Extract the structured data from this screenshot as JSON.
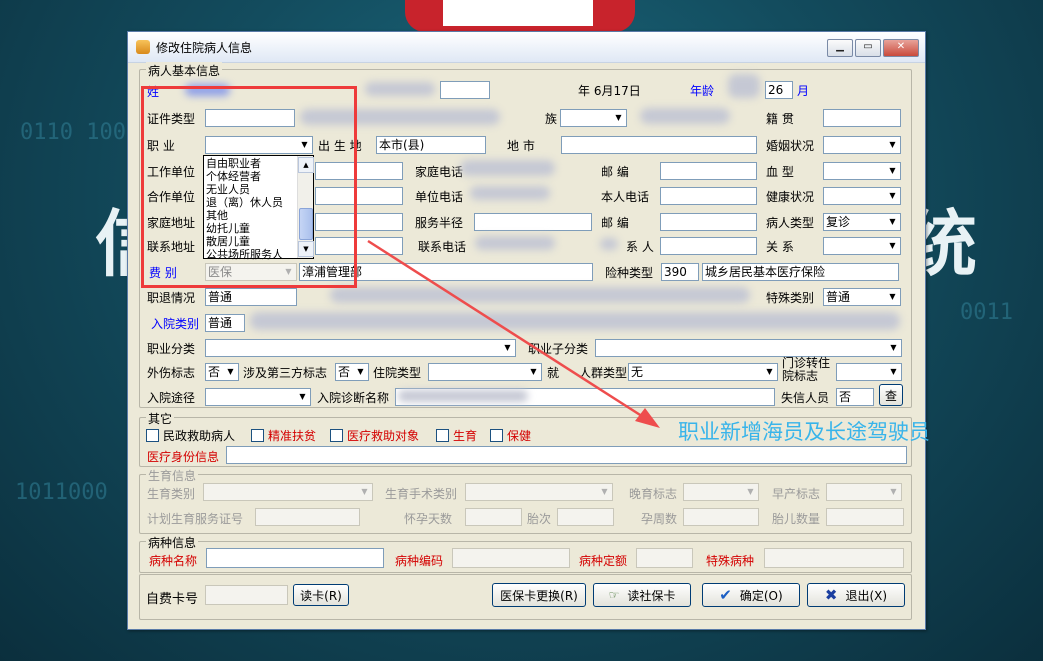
{
  "window": {
    "title": "修改住院病人信息"
  },
  "annotation": "职业新增海员及长途驾驶员",
  "basic": {
    "title": "病人基本信息",
    "name_label": "姓",
    "date_frag": "年 6月17日",
    "age_label": "年龄",
    "age_value": "26",
    "month_label": "月",
    "idtype_label": "证件类型",
    "nation_frag": "族",
    "native_label": "籍    贯",
    "job_label": "职    业",
    "birthplace_label": "出 生 地",
    "birthplace_value": "本市(县)",
    "city_label": "地    市",
    "marital_label": "婚姻状况",
    "work_label": "工作单位",
    "homephone_label": "家庭电话",
    "postcode_label": "邮    编",
    "blood_label": "血    型",
    "coop_label": "合作单位",
    "unitphone_label": "单位电话",
    "selfphone_label": "本人电话",
    "health_label": "健康状况",
    "homeaddr_label": "家庭地址",
    "radius_label": "服务半径",
    "postcode2_label": "邮    编",
    "patienttype_label": "病人类型",
    "patienttype_value": "复诊",
    "contactaddr_label": "联系地址",
    "contactphone_label": "联系电话",
    "contact_label": "系 人",
    "relation_label": "关    系",
    "fee_label": "费    别",
    "fee_value": "医保",
    "fee_unit": "漳浦管理部",
    "insure_label": "险种类型",
    "insure_code": "390",
    "insure_name": "城乡居民基本医疗保险",
    "staff_label": "职退情况",
    "staff_value": "普通",
    "special_label": "特殊类别",
    "special_value": "普通",
    "admitcat_label": "入院类别",
    "admitcat_value": "普通",
    "jobcat_label": "职业分类",
    "jobsub_label": "职业子分类",
    "injury_label": "外伤标志",
    "injury_value": "否",
    "third_label": "涉及第三方标志",
    "third_value": "否",
    "admtype_label": "住院类型",
    "crowd_label": "就",
    "crowd_label2": "人群类型",
    "crowd_value": "无",
    "outpat_label": "门诊转住院标志",
    "route_label": "入院途径",
    "diag_label": "入院诊断名称",
    "lost_label": "失信人员",
    "lost_value": "否",
    "query_button": "查"
  },
  "job_options": [
    "自由职业者",
    "个体经营者",
    "无业人员",
    "退（离）休人员",
    "其他",
    "幼托儿童",
    "散居儿童",
    "公共场所服务人"
  ],
  "other": {
    "title": "其它",
    "checks": [
      "民政救助病人",
      "精准扶贫",
      "医疗救助对象",
      "生育",
      "保健"
    ],
    "medid_label": "医疗身份信息"
  },
  "birth": {
    "title": "生育信息",
    "type_label": "生育类别",
    "surgery_label": "生育手术类别",
    "late_label": "晚育标志",
    "premature_label": "早产标志",
    "cert_label": "计划生育服务证号",
    "days_label": "怀孕天数",
    "parity_label": "胎次",
    "weeks_label": "孕周数",
    "fetus_label": "胎儿数量"
  },
  "disease": {
    "title": "病种信息",
    "name_label": "病种名称",
    "code_label": "病种编码",
    "quota_label": "病种定额",
    "special_label": "特殊病种"
  },
  "footer": {
    "card_label": "自费卡号",
    "read_button": "读卡(R)",
    "change_button": "医保卡更换(R)",
    "social_button": "读社保卡",
    "ok_button": "确定(O)",
    "exit_button": "退出(X)"
  },
  "colors": {
    "accent_red": "#ee3b3b",
    "annotation_blue": "#38b4ea"
  }
}
